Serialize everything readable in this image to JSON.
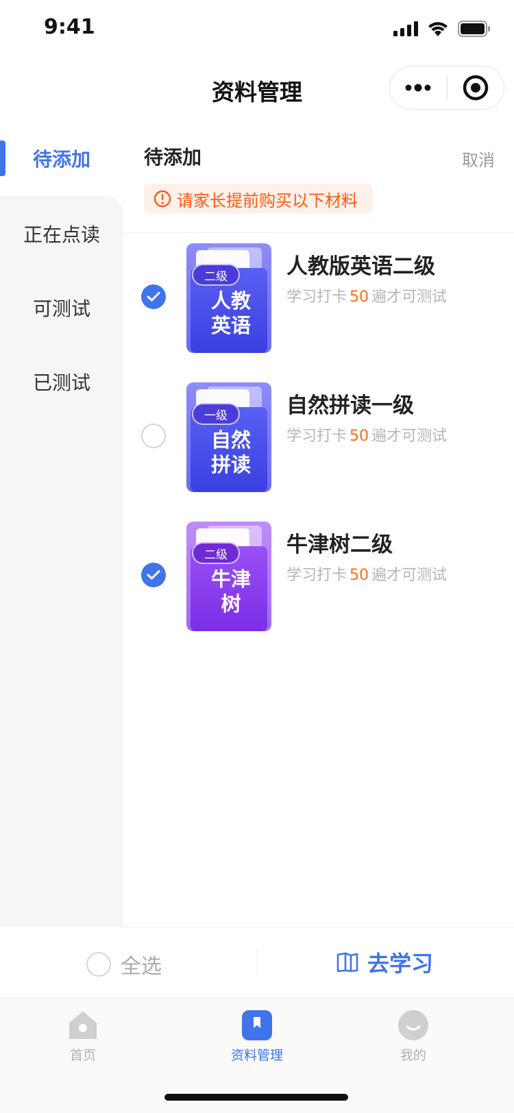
{
  "status_bar": {
    "time": "9:41"
  },
  "nav": {
    "title": "资料管理"
  },
  "sidebar": {
    "items": [
      {
        "label": "待添加",
        "active": true
      },
      {
        "label": "正在点读",
        "active": false
      },
      {
        "label": "可测试",
        "active": false
      },
      {
        "label": "已测试",
        "active": false
      }
    ]
  },
  "main": {
    "section_title": "待添加",
    "cancel": "取消",
    "notice": "请家长提前购买以下材料",
    "items": [
      {
        "badge": "二级",
        "cover_title": "人教\n英语",
        "name": "人教版英语二级",
        "desc_prefix": "学习打卡",
        "count": "50",
        "desc_suffix": "遍才可测试",
        "checked": true,
        "cover_color": "#4a52ee"
      },
      {
        "badge": "一级",
        "cover_title": "自然\n拼读",
        "name": "自然拼读一级",
        "desc_prefix": "学习打卡",
        "count": "50",
        "desc_suffix": "遍才可测试",
        "checked": false,
        "cover_color": "#4a52ee"
      },
      {
        "badge": "二级",
        "cover_title": "牛津\n树",
        "name": "牛津树二级",
        "desc_prefix": "学习打卡",
        "count": "50",
        "desc_suffix": "遍才可测试",
        "checked": true,
        "cover_color": "#8a3ff0"
      }
    ]
  },
  "action_bar": {
    "select_all": "全选",
    "go_learn": "去学习"
  },
  "tab_bar": {
    "tabs": [
      {
        "label": "首页",
        "icon": "home-icon",
        "active": false
      },
      {
        "label": "资料管理",
        "icon": "bookmark-icon",
        "active": true
      },
      {
        "label": "我的",
        "icon": "profile-icon",
        "active": false
      }
    ]
  },
  "colors": {
    "accent": "#3f74ea",
    "warning": "#ff5a12",
    "number": "#ff6a1a"
  }
}
